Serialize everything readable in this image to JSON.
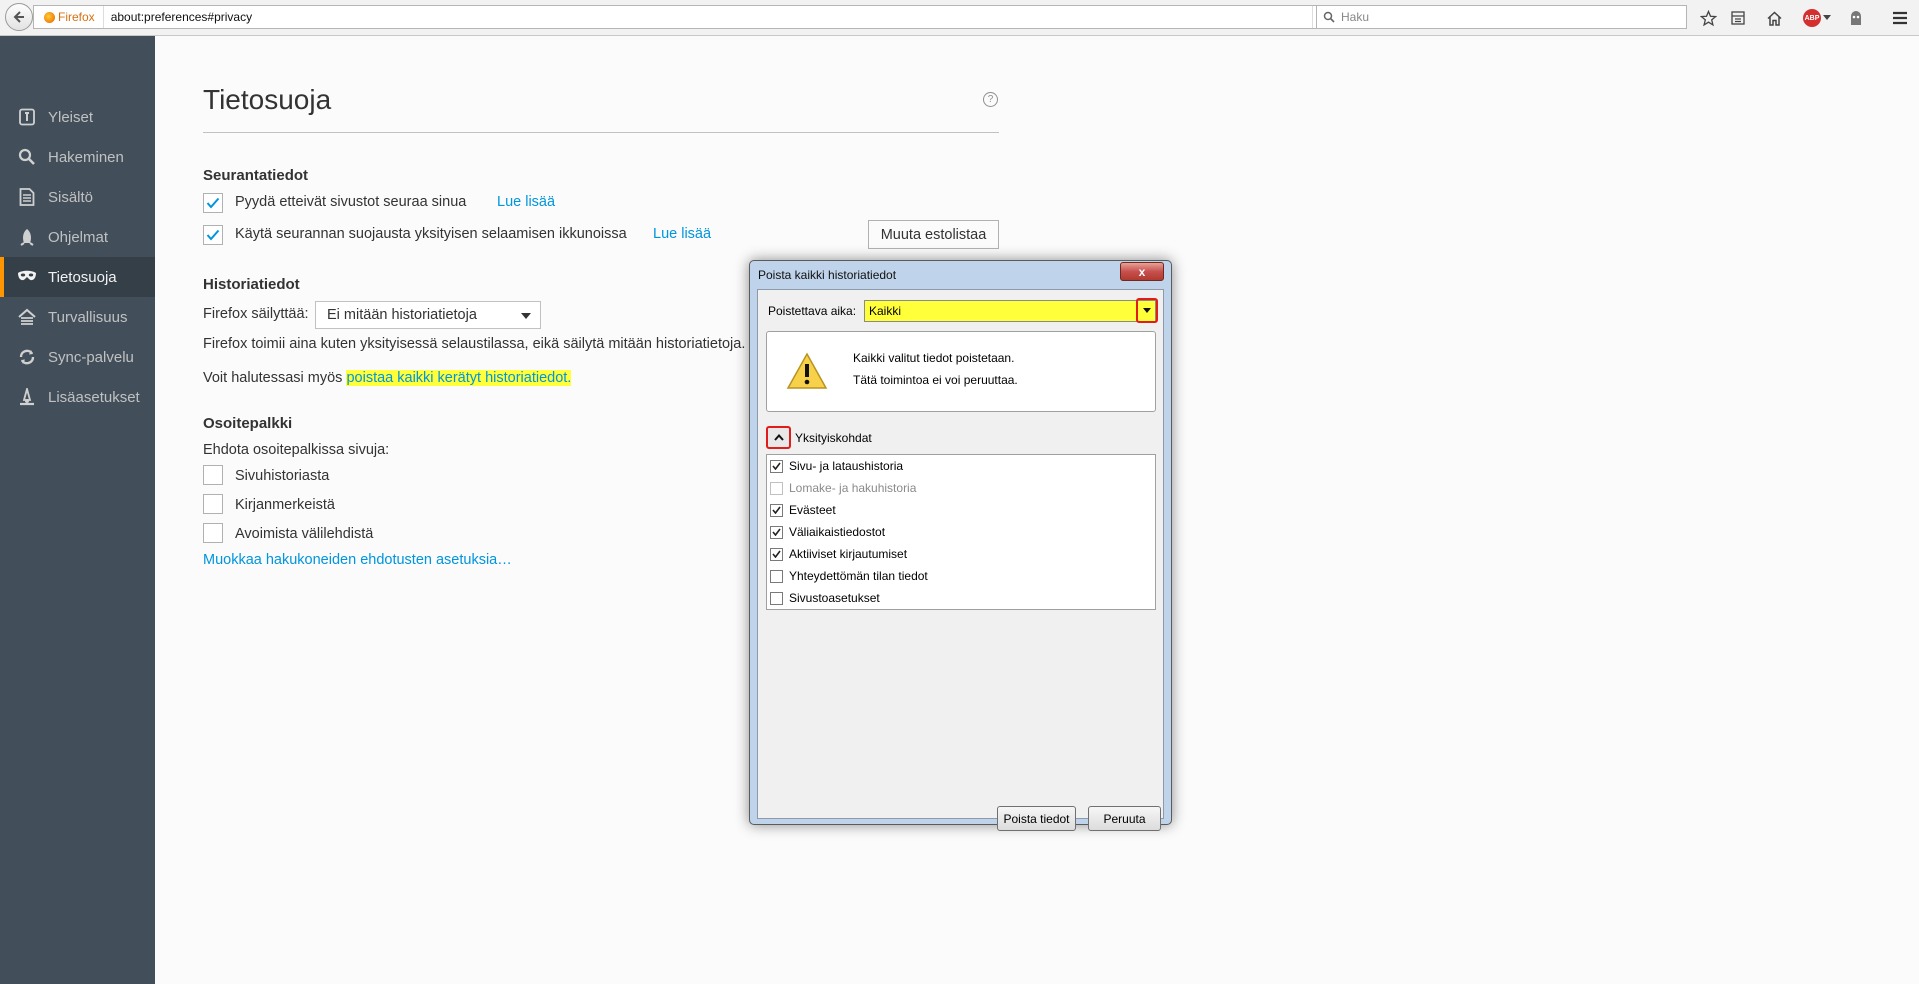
{
  "browser": {
    "identity_label": "Firefox",
    "url": "about:preferences#privacy",
    "search_placeholder": "Haku",
    "abp_label": "ABP"
  },
  "sidebar": {
    "items": [
      {
        "label": "Yleiset",
        "icon": "general-icon"
      },
      {
        "label": "Hakeminen",
        "icon": "search-icon"
      },
      {
        "label": "Sisältö",
        "icon": "content-icon"
      },
      {
        "label": "Ohjelmat",
        "icon": "applications-icon"
      },
      {
        "label": "Tietosuoja",
        "icon": "privacy-mask-icon",
        "selected": true
      },
      {
        "label": "Turvallisuus",
        "icon": "security-icon"
      },
      {
        "label": "Sync-palvelu",
        "icon": "sync-icon"
      },
      {
        "label": "Lisäasetukset",
        "icon": "advanced-icon"
      }
    ]
  },
  "page": {
    "title": "Tietosuoja",
    "help_glyph": "?",
    "tracking": {
      "heading": "Seurantatiedot",
      "dnt_label": "Pyydä etteivät sivustot seuraa sinua",
      "dnt_checked": true,
      "dnt_link": "Lue lisää",
      "tp_label": "Käytä seurannan suojausta yksityisen selaamisen ikkunoissa",
      "tp_checked": true,
      "tp_link": "Lue lisää",
      "blocklist_button": "Muuta estolistaa"
    },
    "history": {
      "heading": "Historiatiedot",
      "mode_label": "Firefox säilyttää:",
      "mode_value": "Ei mitään historiatietoja",
      "description": "Firefox toimii aina kuten yksityisessä selaustilassa, eikä säilytä mitään historiatietoja.",
      "clear_prefix": "Voit halutessasi myös",
      "clear_link": "poistaa kaikki kerätyt historiatiedot."
    },
    "locationbar": {
      "heading": "Osoitepalkki",
      "suggest_label": "Ehdota osoitepalkissa sivuja:",
      "options": [
        {
          "label": "Sivuhistoriasta",
          "checked": false
        },
        {
          "label": "Kirjanmerkeistä",
          "checked": false
        },
        {
          "label": "Avoimista välilehdistä",
          "checked": false
        }
      ],
      "search_suggestions_link": "Muokkaa hakukoneiden ehdotusten asetuksia…"
    }
  },
  "dialog": {
    "title": "Poista kaikki historiatiedot",
    "close_glyph": "x",
    "time_range_label": "Poistettava aika:",
    "time_range_value": "Kaikki",
    "warning_line1": "Kaikki valitut tiedot poistetaan.",
    "warning_line2": "Tätä toimintoa ei voi peruuttaa.",
    "details_label": "Yksityiskohdat",
    "items": [
      {
        "label": "Sivu- ja lataushistoria",
        "checked": true,
        "disabled": false
      },
      {
        "label": "Lomake- ja hakuhistoria",
        "checked": false,
        "disabled": true
      },
      {
        "label": "Evästeet",
        "checked": true,
        "disabled": false
      },
      {
        "label": "Väliaikaistiedostot",
        "checked": true,
        "disabled": false
      },
      {
        "label": "Aktiiviset kirjautumiset",
        "checked": true,
        "disabled": false
      },
      {
        "label": "Yhteydettömän tilan tiedot",
        "checked": false,
        "disabled": false
      },
      {
        "label": "Sivustoasetukset",
        "checked": false,
        "disabled": false
      }
    ],
    "clear_button": "Poista tiedot",
    "cancel_button": "Peruuta"
  },
  "colors": {
    "accent_link": "#0095dd",
    "sidebar_bg": "#424f5a",
    "selected_indicator": "#ff9500",
    "highlight": "#ffff3a",
    "annotation_red": "#e21b1b"
  }
}
